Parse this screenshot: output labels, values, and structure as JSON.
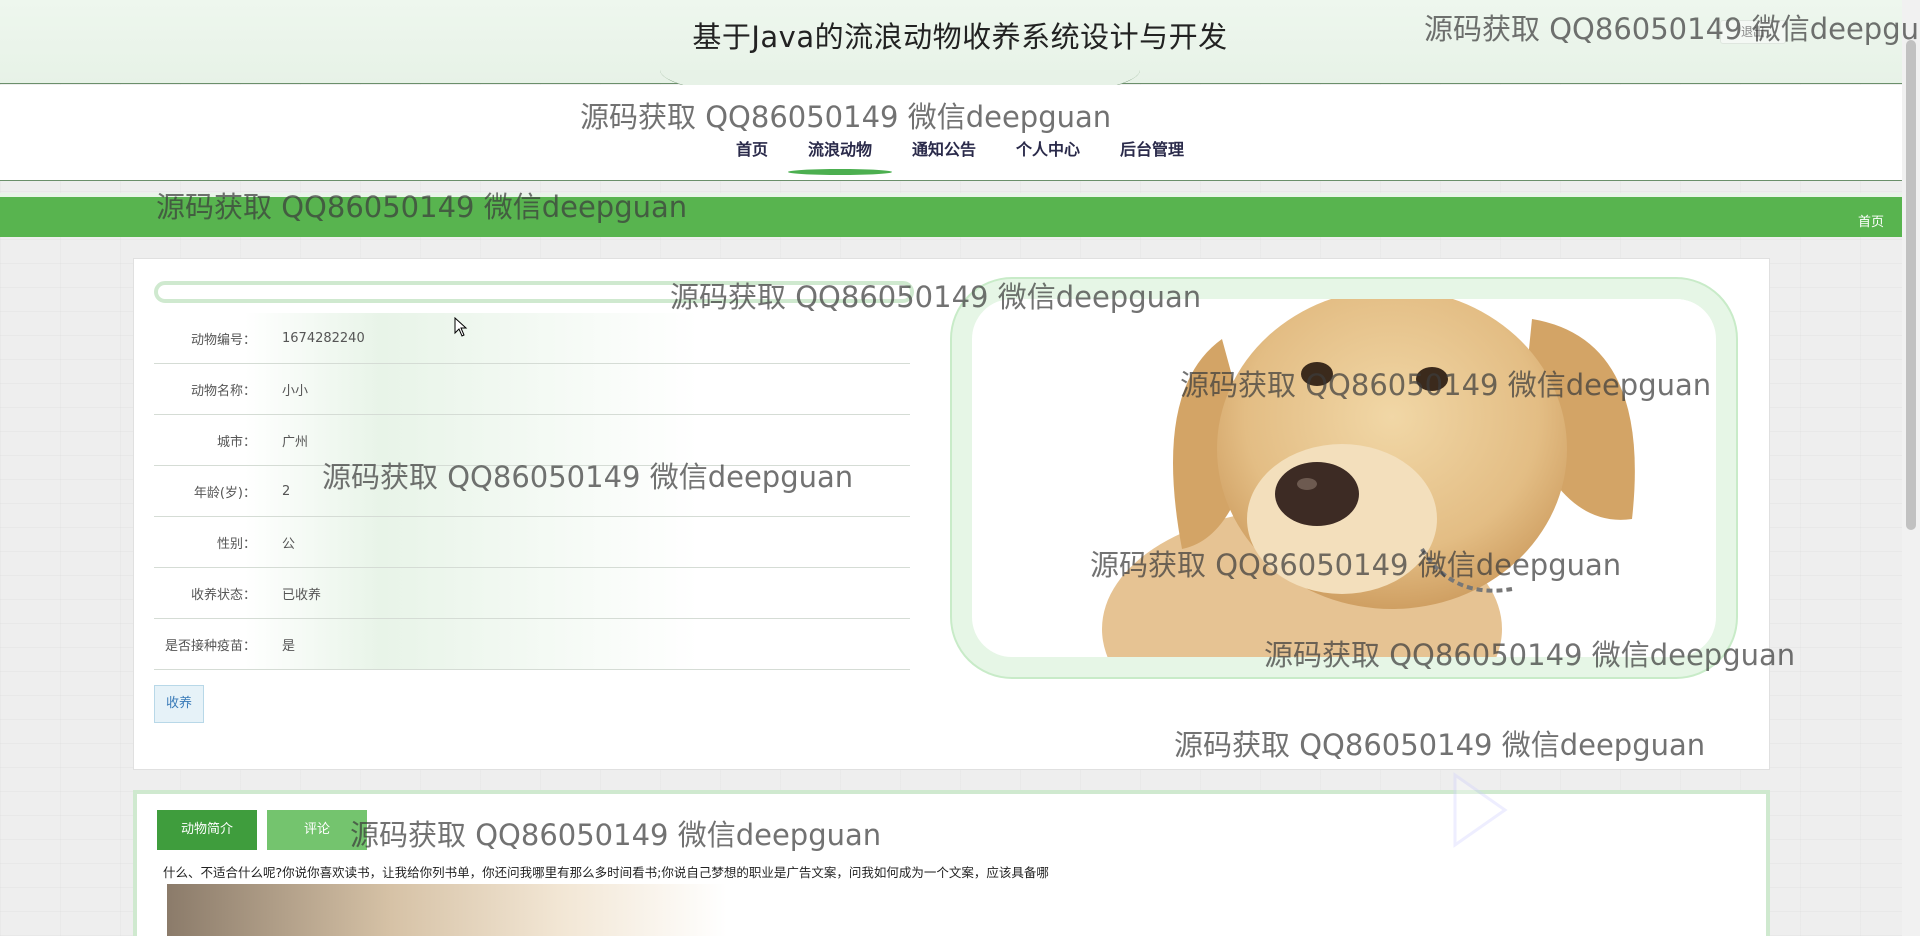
{
  "header": {
    "title": "基于Java的流浪动物收养系统设计与开发",
    "logout_label": "退出"
  },
  "nav": {
    "items": [
      {
        "label": "首页"
      },
      {
        "label": "流浪动物",
        "active": true
      },
      {
        "label": "通知公告"
      },
      {
        "label": "个人中心"
      },
      {
        "label": "后台管理"
      }
    ]
  },
  "breadcrumb": {
    "home": "首页"
  },
  "detail": {
    "rows": [
      {
        "label": "动物编号：",
        "value": "1674282240"
      },
      {
        "label": "动物名称：",
        "value": "小小"
      },
      {
        "label": "城市：",
        "value": "广州"
      },
      {
        "label": "年龄(岁)：",
        "value": "2"
      },
      {
        "label": "性别：",
        "value": "公"
      },
      {
        "label": "收养状态：",
        "value": "已收养"
      },
      {
        "label": "是否接种疫苗：",
        "value": "是"
      }
    ],
    "adopt_button": "收养",
    "image_icon": "dog-photo"
  },
  "tabs": {
    "intro_label": "动物简介",
    "comment_label": "评论",
    "intro_text": "什么、不适合什么呢?你说你喜欢读书，让我给你列书单，你还问我哪里有那么多时间看书;你说自己梦想的职业是广告文案，问我如何成为一个文案，应该具备哪"
  },
  "watermark_text": "源码获取 QQ86050149 微信deepguan",
  "colors": {
    "accent_green": "#58b44f",
    "tab_active": "#3f9d3d",
    "tab_inactive": "#74c46e",
    "pill_border": "#cfe9cf"
  }
}
